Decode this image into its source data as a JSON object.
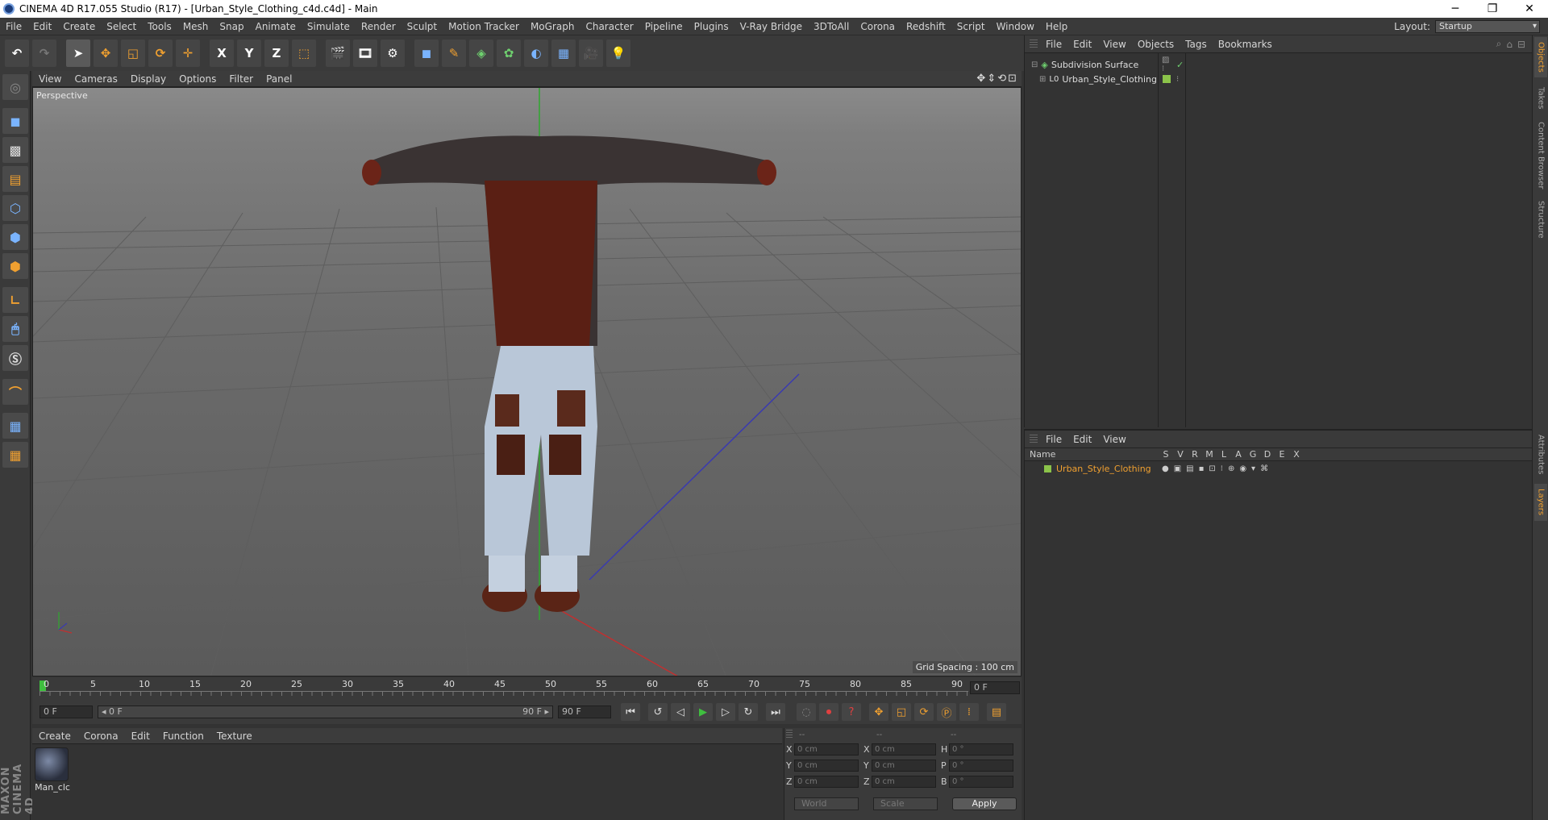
{
  "window": {
    "title": "CINEMA 4D R17.055 Studio (R17) - [Urban_Style_Clothing_c4d.c4d] - Main",
    "minimize": "─",
    "maximize": "❐",
    "close": "✕"
  },
  "menubar": {
    "items": [
      "File",
      "Edit",
      "Create",
      "Select",
      "Tools",
      "Mesh",
      "Snap",
      "Animate",
      "Simulate",
      "Render",
      "Sculpt",
      "Motion Tracker",
      "MoGraph",
      "Character",
      "Pipeline",
      "Plugins",
      "V-Ray Bridge",
      "3DToAll",
      "Corona",
      "Redshift",
      "Script",
      "Window",
      "Help"
    ],
    "layout_label": "Layout:",
    "layout_value": "Startup"
  },
  "toolbar": {
    "x": "X",
    "y": "Y",
    "z": "Z"
  },
  "viewport": {
    "menu": [
      "View",
      "Cameras",
      "Display",
      "Options",
      "Filter",
      "Panel"
    ],
    "label": "Perspective",
    "grid_spacing": "Grid Spacing : 100 cm",
    "nav_icons": "✥⇕⟲⊡"
  },
  "timeline": {
    "ticks": [
      "0",
      "5",
      "10",
      "15",
      "20",
      "25",
      "30",
      "35",
      "40",
      "45",
      "50",
      "55",
      "60",
      "65",
      "70",
      "75",
      "80",
      "85",
      "90"
    ],
    "current_frame": "0 F"
  },
  "anim": {
    "start": "0 F",
    "range_start": "◂ 0 F",
    "range_end": "90 F ▸",
    "end": "90 F"
  },
  "materials": {
    "menu": [
      "Create",
      "Corona",
      "Edit",
      "Function",
      "Texture"
    ],
    "items": [
      {
        "label": "Man_clc"
      }
    ]
  },
  "coords": {
    "headers": [
      "--",
      "--",
      "--"
    ],
    "rows": [
      {
        "l1": "X",
        "v1": "0 cm",
        "l2": "X",
        "v2": "0 cm",
        "l3": "H",
        "v3": "0 °"
      },
      {
        "l1": "Y",
        "v1": "0 cm",
        "l2": "Y",
        "v2": "0 cm",
        "l3": "P",
        "v3": "0 °"
      },
      {
        "l1": "Z",
        "v1": "0 cm",
        "l2": "Z",
        "v2": "0 cm",
        "l3": "B",
        "v3": "0 °"
      }
    ],
    "mode": "World",
    "type": "Scale",
    "apply": "Apply"
  },
  "objects": {
    "menu": [
      "File",
      "Edit",
      "View",
      "Objects",
      "Tags",
      "Bookmarks"
    ],
    "tree": [
      {
        "name": "Subdivision Surface"
      },
      {
        "name": "Urban_Style_Clothing"
      }
    ]
  },
  "layers": {
    "menu": [
      "File",
      "Edit",
      "View"
    ],
    "header": {
      "name": "Name",
      "flags": [
        "S",
        "V",
        "R",
        "M",
        "L",
        "A",
        "G",
        "D",
        "E",
        "X"
      ]
    },
    "rows": [
      {
        "name": "Urban_Style_Clothing"
      }
    ]
  },
  "sidetabs": [
    "Objects",
    "Takes",
    "Content Browser",
    "Structure",
    "Attributes",
    "Layers"
  ],
  "brand": "MAXON CINEMA 4D",
  "colors": {
    "accent": "#f0a030",
    "layer_green": "#8bc34a",
    "layer_name": "#f0a030"
  }
}
